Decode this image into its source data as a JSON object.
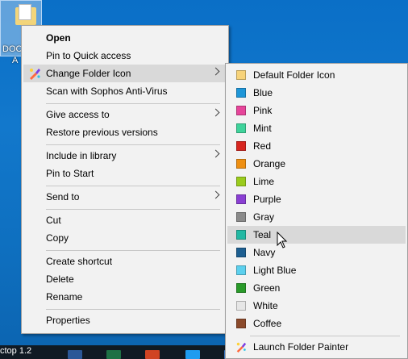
{
  "desktop": {
    "icon_label_line1": "DOC",
    "icon_label_line2": "A",
    "taskbar_text": "ctop 1.2"
  },
  "context_menu": {
    "items": [
      {
        "label": "Open",
        "bold": true
      },
      {
        "label": "Pin to Quick access"
      },
      {
        "label": "Change Folder Icon",
        "submenu": true,
        "highlighted": true,
        "icon": "folder-painter-brush-icon"
      },
      {
        "label": "Scan with Sophos Anti-Virus"
      },
      {
        "label": "Give access to",
        "submenu": true
      },
      {
        "label": "Restore previous versions"
      },
      {
        "label": "Include in library",
        "submenu": true
      },
      {
        "label": "Pin to Start"
      },
      {
        "label": "Send to",
        "submenu": true
      },
      {
        "label": "Cut"
      },
      {
        "label": "Copy"
      },
      {
        "label": "Create shortcut"
      },
      {
        "label": "Delete"
      },
      {
        "label": "Rename"
      },
      {
        "label": "Properties"
      }
    ]
  },
  "submenu": {
    "items": [
      {
        "label": "Default Folder Icon",
        "color": "#f7d37a"
      },
      {
        "label": "Blue",
        "color": "#1e96d8"
      },
      {
        "label": "Pink",
        "color": "#e6459a"
      },
      {
        "label": "Mint",
        "color": "#3fd39b"
      },
      {
        "label": "Red",
        "color": "#d7261f"
      },
      {
        "label": "Orange",
        "color": "#ee8f12"
      },
      {
        "label": "Lime",
        "color": "#9acb1c"
      },
      {
        "label": "Purple",
        "color": "#8a3fd3"
      },
      {
        "label": "Gray",
        "color": "#8a8a8a"
      },
      {
        "label": "Teal",
        "color": "#22b8a3",
        "highlighted": true
      },
      {
        "label": "Navy",
        "color": "#1d5f91"
      },
      {
        "label": "Light Blue",
        "color": "#5cd0ee"
      },
      {
        "label": "Green",
        "color": "#2a9b2a"
      },
      {
        "label": "White",
        "color": "#e6e6e6"
      },
      {
        "label": "Coffee",
        "color": "#8b4a2b"
      }
    ],
    "launch_label": "Launch Folder Painter"
  }
}
